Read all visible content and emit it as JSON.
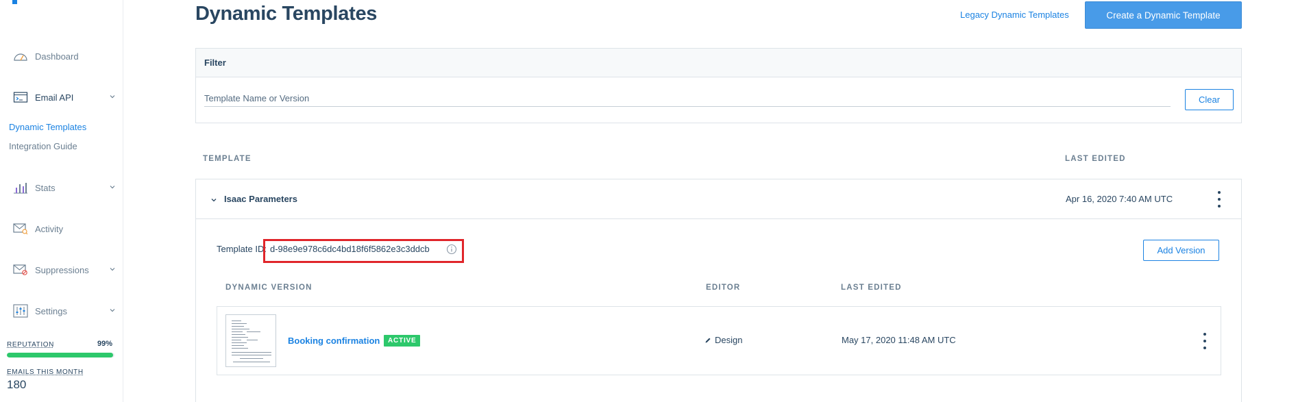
{
  "sidebar": {
    "items": [
      {
        "id": "dashboard",
        "label": "Dashboard",
        "icon": "speedometer-icon"
      },
      {
        "id": "email-api",
        "label": "Email API",
        "icon": "terminal-window-icon"
      },
      {
        "id": "stats",
        "label": "Stats",
        "icon": "bar-chart-icon"
      },
      {
        "id": "activity",
        "label": "Activity",
        "icon": "mail-search-icon"
      },
      {
        "id": "suppressions",
        "label": "Suppressions",
        "icon": "mail-blocked-icon"
      },
      {
        "id": "settings",
        "label": "Settings",
        "icon": "sliders-icon"
      }
    ],
    "sub_items": [
      "Dynamic Templates",
      "Integration Guide"
    ],
    "reputation": {
      "label": "REPUTATION",
      "value": "99%",
      "fraction": 0.99
    },
    "emails_this_month": {
      "label": "EMAILS THIS MONTH",
      "value": "180"
    }
  },
  "header": {
    "title": "Dynamic Templates",
    "legacy_link": "Legacy Dynamic Templates",
    "create_button": "Create a Dynamic Template"
  },
  "filter": {
    "title": "Filter",
    "placeholder": "Template Name or Version",
    "clear_button": "Clear"
  },
  "table": {
    "columns": [
      "TEMPLATE",
      "LAST EDITED"
    ],
    "template": {
      "name": "Isaac Parameters",
      "last_edited": "Apr 16, 2020 7:40 AM UTC",
      "id_label": "Template ID:",
      "id_value": "d-98e9e978c6dc4bd18f6f5862e3c3ddcb",
      "add_version_button": "Add Version",
      "version_columns": [
        "DYNAMIC VERSION",
        "EDITOR",
        "LAST EDITED"
      ],
      "versions": [
        {
          "name": "Booking confirmation",
          "badge": "ACTIVE",
          "editor": "Design",
          "last_edited": "May 17, 2020 11:48 AM UTC"
        }
      ]
    }
  },
  "colors": {
    "accent": "#1a82e2",
    "primary_button": "#489be8",
    "active_badge": "#2dc86b",
    "highlight": "#e0252a"
  }
}
